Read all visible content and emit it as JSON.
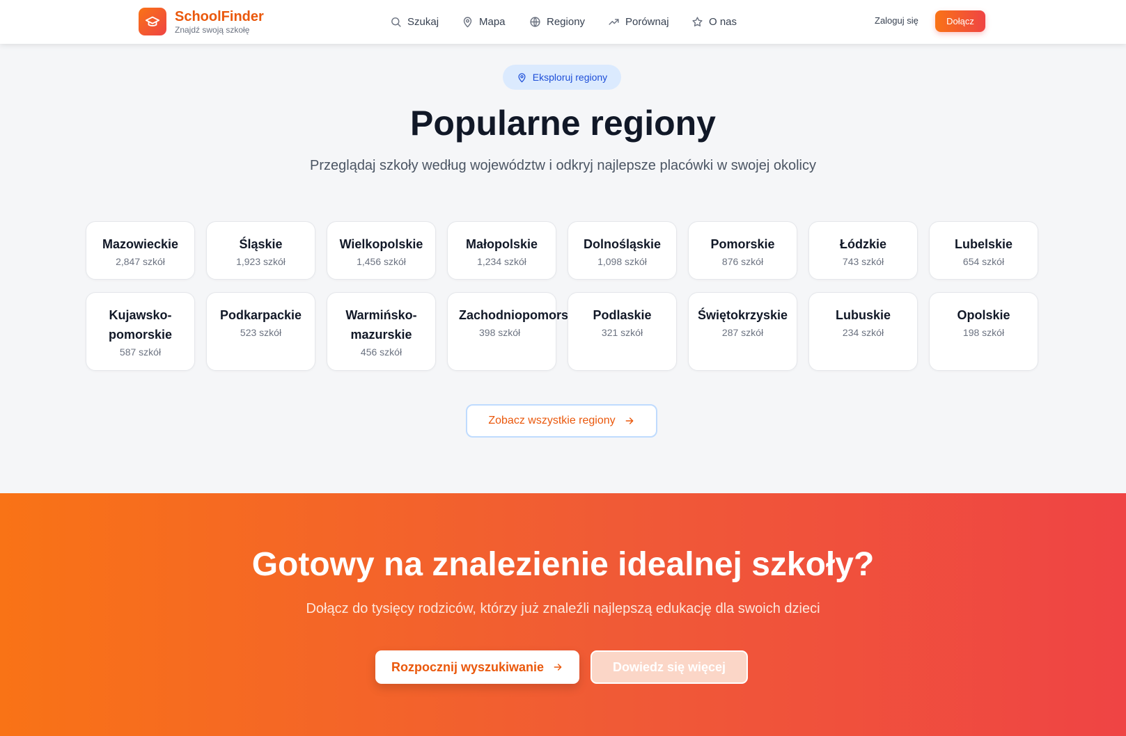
{
  "header": {
    "brand": "SchoolFinder",
    "tagline": "Znajdź swoją szkołę",
    "nav": [
      {
        "label": "Szukaj",
        "icon": "search-icon"
      },
      {
        "label": "Mapa",
        "icon": "map-pin-icon"
      },
      {
        "label": "Regiony",
        "icon": "globe-icon"
      },
      {
        "label": "Porównaj",
        "icon": "trending-up-icon"
      },
      {
        "label": "O nas",
        "icon": "star-icon"
      }
    ],
    "login": "Zaloguj się",
    "join": "Dołącz"
  },
  "regions_section": {
    "badge": "Eksploruj regiony",
    "title": "Popularne regiony",
    "subtitle": "Przeglądaj szkoły według województw i odkryj najlepsze placówki w swojej okolicy",
    "regions": [
      {
        "name": "Mazowieckie",
        "count": "2,847 szkół"
      },
      {
        "name": "Śląskie",
        "count": "1,923 szkół"
      },
      {
        "name": "Wielkopolskie",
        "count": "1,456 szkół"
      },
      {
        "name": "Małopolskie",
        "count": "1,234 szkół"
      },
      {
        "name": "Dolnośląskie",
        "count": "1,098 szkół"
      },
      {
        "name": "Pomorskie",
        "count": "876 szkół"
      },
      {
        "name": "Łódzkie",
        "count": "743 szkół"
      },
      {
        "name": "Lubelskie",
        "count": "654 szkół"
      },
      {
        "name": "Kujawsko-pomorskie",
        "count": "587 szkół"
      },
      {
        "name": "Podkarpackie",
        "count": "523 szkół"
      },
      {
        "name": "Warmińsko-mazurskie",
        "count": "456 szkół"
      },
      {
        "name": "Zachodniopomorskie",
        "count": "398 szkół"
      },
      {
        "name": "Podlaskie",
        "count": "321 szkół"
      },
      {
        "name": "Świętokrzyskie",
        "count": "287 szkół"
      },
      {
        "name": "Lubuskie",
        "count": "234 szkół"
      },
      {
        "name": "Opolskie",
        "count": "198 szkół"
      }
    ],
    "all_button": "Zobacz wszystkie regiony"
  },
  "cta": {
    "title": "Gotowy na znalezienie idealnej szkoły?",
    "subtitle": "Dołącz do tysięcy rodziców, którzy już znaleźli najlepszą edukację dla swoich dzieci",
    "primary": "Rozpocznij wyszukiwanie",
    "secondary": "Dowiedz się więcej"
  },
  "colors": {
    "accent": "#ea580c",
    "gradient_start": "#f97316",
    "gradient_end": "#ef4444",
    "badge_bg": "#dbeafe",
    "badge_text": "#1d4ed8"
  }
}
